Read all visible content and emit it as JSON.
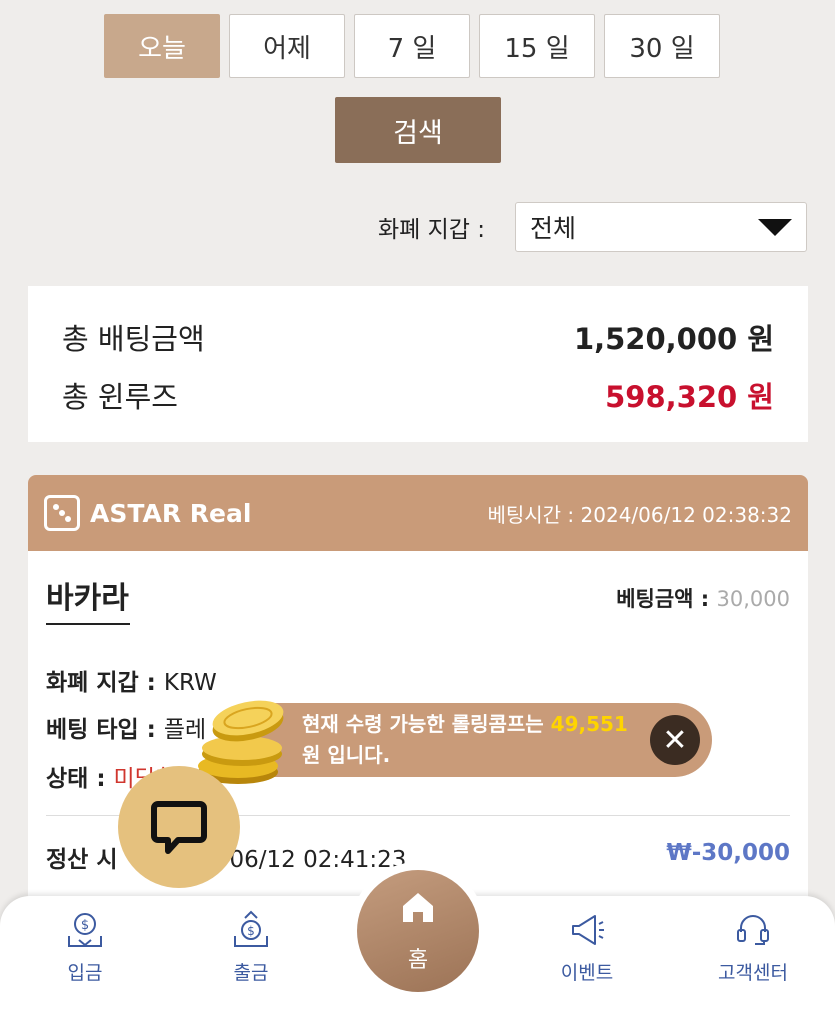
{
  "filters": {
    "periods": [
      "오늘",
      "어제",
      "7 일",
      "15 일",
      "30 일"
    ],
    "active_period": "오늘",
    "search_label": "검색",
    "wallet_label": "화폐 지갑 :",
    "wallet_value": "전체"
  },
  "summary": {
    "total_bet_label": "총 배팅금액",
    "total_bet_value": "1,520,000 원",
    "total_winloss_label": "총 윈루즈",
    "total_winloss_value": "598,320 원",
    "winloss_color": "#c8102e"
  },
  "card": {
    "provider": "ASTAR Real",
    "bet_time_label": "베팅시간 :",
    "bet_time_value": "2024/06/12 02:38:32",
    "game": "바카라",
    "bet_amount_label": "베팅금액 :",
    "bet_amount_value": "30,000",
    "wallet_label": "화폐 지갑 :",
    "wallet_value": "KRW",
    "bet_type_label": "베팅 타입 :",
    "bet_type_value": "플레",
    "status_label": "상태 :",
    "status_value": "미당첨",
    "settle_label": "정산 시",
    "settle_value": "06/12 02:41:23",
    "settle_amount": "₩-30,000"
  },
  "toast": {
    "line1_prefix": "현재 수령 가능한 롤링콤프는",
    "amount": "49,551",
    "line2": "원 입니다."
  },
  "nav": {
    "deposit": "입금",
    "withdraw": "출금",
    "home": "홈",
    "event": "이벤트",
    "support": "고객센터"
  },
  "colors": {
    "accent": "#c99b79",
    "search_button": "#8a6e58",
    "nav_icon": "#3c5aa0",
    "settle_amount": "#5d77c6"
  }
}
